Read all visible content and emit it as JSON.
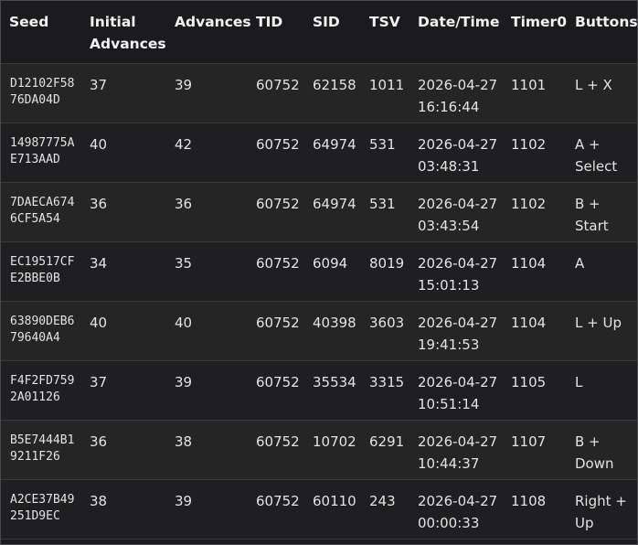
{
  "headers": {
    "seed": "Seed",
    "initial_advances": "Initial Advances",
    "advances": "Advances",
    "tid": "TID",
    "sid": "SID",
    "tsv": "TSV",
    "datetime": "Date/Time",
    "timer0": "Timer0",
    "buttons": "Buttons"
  },
  "rows": [
    {
      "seed": "D12102F5876DA04D",
      "initial_advances": "37",
      "advances": "39",
      "tid": "60752",
      "sid": "62158",
      "tsv": "1011",
      "datetime": "2026-04-27 16:16:44",
      "timer0": "1101",
      "buttons": "L + X"
    },
    {
      "seed": "14987775AE713AAD",
      "initial_advances": "40",
      "advances": "42",
      "tid": "60752",
      "sid": "64974",
      "tsv": "531",
      "datetime": "2026-04-27 03:48:31",
      "timer0": "1102",
      "buttons": "A + Select"
    },
    {
      "seed": "7DAECA6746CF5A54",
      "initial_advances": "36",
      "advances": "36",
      "tid": "60752",
      "sid": "64974",
      "tsv": "531",
      "datetime": "2026-04-27 03:43:54",
      "timer0": "1102",
      "buttons": "B + Start"
    },
    {
      "seed": "EC19517CFE2BBE0B",
      "initial_advances": "34",
      "advances": "35",
      "tid": "60752",
      "sid": "6094",
      "tsv": "8019",
      "datetime": "2026-04-27 15:01:13",
      "timer0": "1104",
      "buttons": "A"
    },
    {
      "seed": "63890DEB679640A4",
      "initial_advances": "40",
      "advances": "40",
      "tid": "60752",
      "sid": "40398",
      "tsv": "3603",
      "datetime": "2026-04-27 19:41:53",
      "timer0": "1104",
      "buttons": "L + Up"
    },
    {
      "seed": "F4F2FD7592A01126",
      "initial_advances": "37",
      "advances": "39",
      "tid": "60752",
      "sid": "35534",
      "tsv": "3315",
      "datetime": "2026-04-27 10:51:14",
      "timer0": "1105",
      "buttons": "L"
    },
    {
      "seed": "B5E7444B19211F26",
      "initial_advances": "36",
      "advances": "38",
      "tid": "60752",
      "sid": "10702",
      "tsv": "6291",
      "datetime": "2026-04-27 10:44:37",
      "timer0": "1107",
      "buttons": "B + Down"
    },
    {
      "seed": "A2CE37B49251D9EC",
      "initial_advances": "38",
      "advances": "39",
      "tid": "60752",
      "sid": "60110",
      "tsv": "243",
      "datetime": "2026-04-27 00:00:33",
      "timer0": "1108",
      "buttons": "Right + Up"
    }
  ]
}
